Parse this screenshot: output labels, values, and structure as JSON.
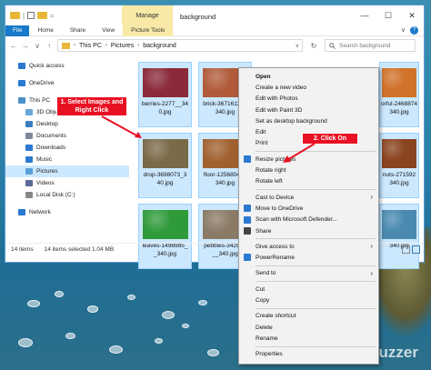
{
  "window": {
    "title": "background",
    "contextual_tab": "Manage",
    "controls": [
      "—",
      "☐",
      "✕"
    ]
  },
  "ribbon": {
    "tabs": [
      "File",
      "Home",
      "Share",
      "View",
      "Picture Tools"
    ],
    "expand_glyph": "∨",
    "help_glyph": "?"
  },
  "address": {
    "back": "←",
    "forward": "→",
    "up_recent": "∨",
    "up": "↑",
    "separator": "›",
    "crumbs": [
      "This PC",
      "Pictures",
      "background"
    ],
    "refresh": "↻",
    "search_placeholder": "Search background"
  },
  "sidebar": {
    "items": [
      {
        "label": "Quick access",
        "icon": "star-icon",
        "color": "#2b79d0"
      },
      {
        "label": "",
        "icon": "",
        "color": ""
      },
      {
        "label": "OneDrive",
        "icon": "cloud-icon",
        "color": "#2b79d0"
      },
      {
        "label": "",
        "icon": "",
        "color": ""
      },
      {
        "label": "This PC",
        "icon": "computer-icon",
        "color": "#4a90c8"
      },
      {
        "label": "3D Objects",
        "icon": "cube-icon",
        "color": "#6aa8d8"
      },
      {
        "label": "Desktop",
        "icon": "desktop-icon",
        "color": "#3a7fc0"
      },
      {
        "label": "Documents",
        "icon": "document-icon",
        "color": "#7a8a99"
      },
      {
        "label": "Downloads",
        "icon": "download-icon",
        "color": "#2b79d0"
      },
      {
        "label": "Music",
        "icon": "music-icon",
        "color": "#2b79d0"
      },
      {
        "label": "Pictures",
        "icon": "pictures-icon",
        "color": "#5aa0d8"
      },
      {
        "label": "Videos",
        "icon": "video-icon",
        "color": "#5a6a99"
      },
      {
        "label": "Local Disk (C:)",
        "icon": "disk-icon",
        "color": "#888888"
      },
      {
        "label": "",
        "icon": "",
        "color": ""
      },
      {
        "label": "Network",
        "icon": "network-icon",
        "color": "#2b79d0"
      }
    ],
    "selected_index": 10
  },
  "files": [
    {
      "name": "berries-2277_340.jpg",
      "caption": "berries-2277__34\n0.jpg",
      "color": "#8a2a3a"
    },
    {
      "name": "brick-3671612_340.jpg",
      "caption": "brick-3671612__\n340.jpg",
      "color": "#b05a3a"
    },
    {
      "name": "colorful-2468874_340.jpg",
      "caption": "orful-2468874\n340.jpg",
      "color": "#d0722a"
    },
    {
      "name": "drop-3698073_340.jpg",
      "caption": "drop-3698073_3\n40.jpg",
      "color": "#7a6a48"
    },
    {
      "name": "floor-1256804_340.jpg",
      "caption": "floor-1256804__\n340.jpg",
      "color": "#a0602e"
    },
    {
      "name": "hazelnuts-271592_340.jpg",
      "caption": "nuts-271592\n340.jpg",
      "color": "#8a4420"
    },
    {
      "name": "leaves-1498985_340.jpg",
      "caption": "leaves-1498985_\n_340.jpg",
      "color": "#2f9a3a"
    },
    {
      "name": "pebbles-342981_340.jpg",
      "caption": "pebbles-342981\n__340.jpg",
      "color": "#8a7a66"
    },
    {
      "name": "340.jpg",
      "caption": "340.jpg",
      "color": "#4a8ab0"
    }
  ],
  "status": {
    "items": "14 items",
    "selected": "14 items selected  1.04 MB"
  },
  "context_menu": {
    "groups": [
      [
        {
          "label": "Open",
          "bold": true
        },
        {
          "label": "Create a new video"
        },
        {
          "label": "Edit with Photos"
        },
        {
          "label": "Edit with Paint 3D"
        },
        {
          "label": "Set as desktop background"
        },
        {
          "label": "Edit"
        },
        {
          "label": "Print"
        }
      ],
      [
        {
          "label": "Resize pictures",
          "icon": "resize-icon",
          "color": "#2b79d0"
        },
        {
          "label": "Rotate right"
        },
        {
          "label": "Rotate left"
        }
      ],
      [
        {
          "label": "Cast to Device",
          "submenu": true
        },
        {
          "label": "Move to OneDrive",
          "icon": "onedrive-icon",
          "color": "#2b79d0"
        },
        {
          "label": "Scan with Microsoft Defender...",
          "icon": "defender-icon",
          "color": "#2b79d0"
        },
        {
          "label": "Share",
          "icon": "share-icon",
          "color": "#444444"
        }
      ],
      [
        {
          "label": "Give access to",
          "submenu": true
        },
        {
          "label": "PowerRename",
          "icon": "powerrename-icon",
          "color": "#2b79d0"
        }
      ],
      [
        {
          "label": "Send to",
          "submenu": true
        }
      ],
      [
        {
          "label": "Cut"
        },
        {
          "label": "Copy"
        }
      ],
      [
        {
          "label": "Create shortcut"
        },
        {
          "label": "Delete"
        },
        {
          "label": "Rename"
        }
      ],
      [
        {
          "label": "Properties"
        }
      ]
    ],
    "submenu_arrow": "›"
  },
  "callouts": {
    "step1": "1. Select Images and Right Click",
    "step2": "2. Click On"
  },
  "watermark": "WinBuzzer",
  "colors": {
    "accent": "#1979ca",
    "selection": "#cce8ff",
    "callout": "#e81123"
  }
}
